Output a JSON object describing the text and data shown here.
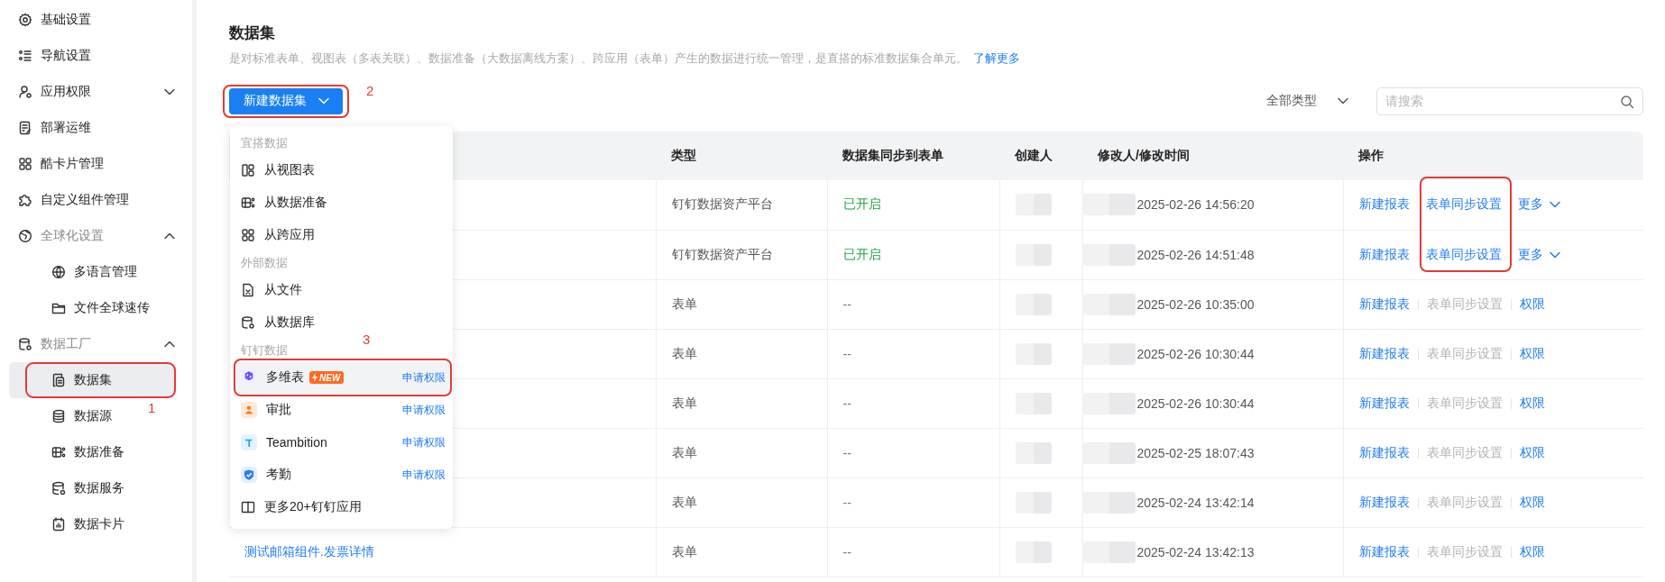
{
  "sidebar": {
    "items": [
      {
        "label": "基础设置",
        "selected": false
      },
      {
        "label": "导航设置",
        "selected": false
      },
      {
        "label": "应用权限",
        "selected": false,
        "expanded": false
      },
      {
        "label": "部署运维",
        "selected": false
      },
      {
        "label": "酷卡片管理",
        "selected": false
      },
      {
        "label": "自定义组件管理",
        "selected": false
      },
      {
        "label": "全球化设置",
        "selected": false,
        "expanded": true,
        "children": [
          {
            "label": "多语言管理",
            "selected": false
          },
          {
            "label": "文件全球速传",
            "selected": false
          }
        ]
      },
      {
        "label": "数据工厂",
        "selected": false,
        "expanded": true,
        "children": [
          {
            "label": "数据集",
            "selected": true,
            "highlighted": true,
            "annotation": "1"
          },
          {
            "label": "数据源",
            "selected": false
          },
          {
            "label": "数据准备",
            "selected": false
          },
          {
            "label": "数据服务",
            "selected": false
          },
          {
            "label": "数据卡片",
            "selected": false
          }
        ]
      }
    ]
  },
  "page": {
    "title": "数据集",
    "description": "是对标准表单、视图表（多表关联）、数据准备（大数据离线方案）、跨应用（表单）产生的数据进行统一管理，是直搭的标准数据集合单元。",
    "learn_more": "了解更多"
  },
  "toolbar": {
    "new_button": {
      "label": "新建数据集",
      "highlighted": true,
      "annotation": "2"
    },
    "type_filter": "全部类型",
    "search": {
      "placeholder": "请搜索"
    }
  },
  "dropdown": {
    "open": true,
    "sections": [
      {
        "title": "宜搭数据",
        "items": [
          {
            "label": "从视图表"
          },
          {
            "label": "从数据准备"
          },
          {
            "label": "从跨应用"
          }
        ]
      },
      {
        "title": "外部数据",
        "items": [
          {
            "label": "从文件"
          },
          {
            "label": "从数据库"
          }
        ]
      },
      {
        "title": "钉钉数据",
        "annotation": "3",
        "items": [
          {
            "label": "多维表",
            "badge": "NEW",
            "action": "申请权限",
            "highlighted": true
          },
          {
            "label": "审批",
            "action": "申请权限",
            "highlighted": false
          },
          {
            "label": "Teambition",
            "action": "申请权限",
            "highlighted": false
          },
          {
            "label": "考勤",
            "action": "申请权限",
            "highlighted": false
          },
          {
            "label": "更多20+钉钉应用"
          }
        ]
      }
    ]
  },
  "table": {
    "sync_settings_highlighted": true,
    "columns": [
      "类型",
      "数据集同步到表单",
      "创建人",
      "修改人/修改时间",
      "操作"
    ],
    "rows": [
      {
        "type": "钉钉数据资产平台",
        "sync": "已开启",
        "sync_on": true,
        "modified_time": "2025-02-26 14:56:20",
        "actions": [
          {
            "label": "新建报表",
            "disabled": false
          },
          {
            "label": "表单同步设置",
            "disabled": false
          },
          {
            "label": "更多",
            "disabled": false,
            "kind": "dropdown"
          }
        ]
      },
      {
        "type": "钉钉数据资产平台",
        "sync": "已开启",
        "sync_on": true,
        "modified_time": "2025-02-26 14:51:48",
        "actions": [
          {
            "label": "新建报表",
            "disabled": false
          },
          {
            "label": "表单同步设置",
            "disabled": false
          },
          {
            "label": "更多",
            "disabled": false,
            "kind": "dropdown"
          }
        ]
      },
      {
        "type": "表单",
        "sync": "--",
        "sync_on": false,
        "modified_time": "2025-02-26 10:35:00",
        "actions": [
          {
            "label": "新建报表",
            "disabled": false
          },
          {
            "label": "表单同步设置",
            "disabled": true
          },
          {
            "label": "权限",
            "disabled": false
          }
        ]
      },
      {
        "type": "表单",
        "sync": "--",
        "sync_on": false,
        "modified_time": "2025-02-26 10:30:44",
        "actions": [
          {
            "label": "新建报表",
            "disabled": false
          },
          {
            "label": "表单同步设置",
            "disabled": true
          },
          {
            "label": "权限",
            "disabled": false
          }
        ]
      },
      {
        "type": "表单",
        "sync": "--",
        "sync_on": false,
        "modified_time": "2025-02-26 10:30:44",
        "actions": [
          {
            "label": "新建报表",
            "disabled": false
          },
          {
            "label": "表单同步设置",
            "disabled": true
          },
          {
            "label": "权限",
            "disabled": false
          }
        ]
      },
      {
        "type": "表单",
        "sync": "--",
        "sync_on": false,
        "modified_time": "2025-02-25 18:07:43",
        "actions": [
          {
            "label": "新建报表",
            "disabled": false
          },
          {
            "label": "表单同步设置",
            "disabled": true
          },
          {
            "label": "权限",
            "disabled": false
          }
        ]
      },
      {
        "type": "表单",
        "sync": "--",
        "sync_on": false,
        "modified_time": "2025-02-24 13:42:14",
        "actions": [
          {
            "label": "新建报表",
            "disabled": false
          },
          {
            "label": "表单同步设置",
            "disabled": true
          },
          {
            "label": "权限",
            "disabled": false
          }
        ]
      },
      {
        "name": "测试邮箱组件.发票详情",
        "type": "表单",
        "sync": "--",
        "sync_on": false,
        "modified_time": "2025-02-24 13:42:13",
        "actions": [
          {
            "label": "新建报表",
            "disabled": false
          },
          {
            "label": "表单同步设置",
            "disabled": true
          },
          {
            "label": "权限",
            "disabled": false
          }
        ]
      }
    ]
  }
}
